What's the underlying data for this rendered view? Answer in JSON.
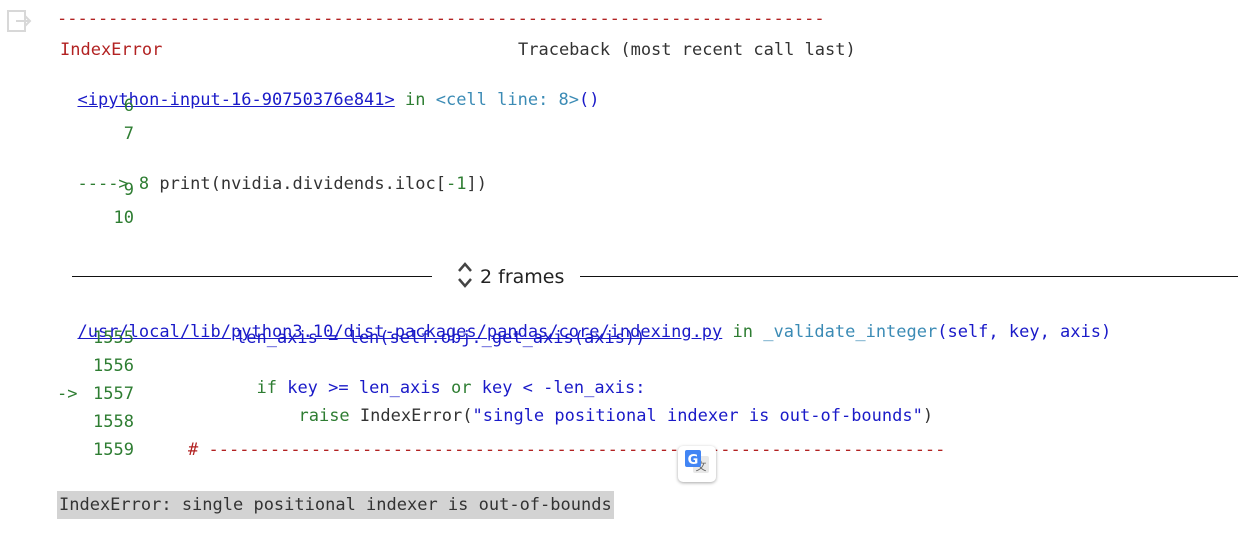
{
  "traceback": {
    "separator": "---------------------------------------------------------------------------",
    "error_name": "IndexError",
    "header": "Traceback (most recent call last)",
    "frame1": {
      "file": "<ipython-input-16-90750376e841>",
      "in_text": " in ",
      "location": "<cell line: 8>",
      "location_suffix": "()",
      "lines": [
        {
          "num": "6",
          "code": ""
        },
        {
          "num": "7",
          "code": ""
        },
        {
          "arrow": "---->",
          "num": "8",
          "code_prefix": "print(nvidia.dividends.iloc[",
          "code_num": "-1",
          "code_suffix": "])"
        },
        {
          "num": "9",
          "code": ""
        },
        {
          "num": "10",
          "code": ""
        }
      ]
    },
    "frames_toggle_label": "2 frames",
    "frame2": {
      "file": "/usr/local/lib/python3.10/dist-packages/pandas/core/indexing.py",
      "in_text": " in ",
      "function": "_validate_integer",
      "args": "(self, key, axis)",
      "lines": [
        {
          "num": "1555",
          "code": "len_axis = len(self.obj._get_axis(axis))"
        },
        {
          "num": "1556",
          "kw1": "if",
          "mid1": " key ",
          "op1": ">=",
          "mid2": " len_axis ",
          "kw2": "or",
          "mid3": " key ",
          "op2": "<",
          "mid4": " -len_axis:"
        },
        {
          "arrow": "->",
          "num": "1557",
          "kw": "raise",
          "exc": " IndexError(",
          "str": "\"single positional indexer is out-of-bounds\"",
          "close": ")"
        },
        {
          "num": "1558",
          "code": ""
        },
        {
          "num": "1559",
          "hash": "#",
          "dashes": " ------------------------------------------------------------------------"
        }
      ]
    },
    "error_summary": "IndexError: single positional indexer is out-of-bounds"
  },
  "colors": {
    "error_red": "#b22222",
    "line_number_green": "#2e7d32",
    "keyword_blue": "#1a1ac8",
    "location_teal": "#3b8bb5",
    "summary_bg": "#d3d3d3"
  },
  "icons": {
    "output_icon": "output-exit-icon",
    "frames_toggle_icon": "unfold-chevron-icon",
    "translate_icon": "google-translate-icon"
  }
}
